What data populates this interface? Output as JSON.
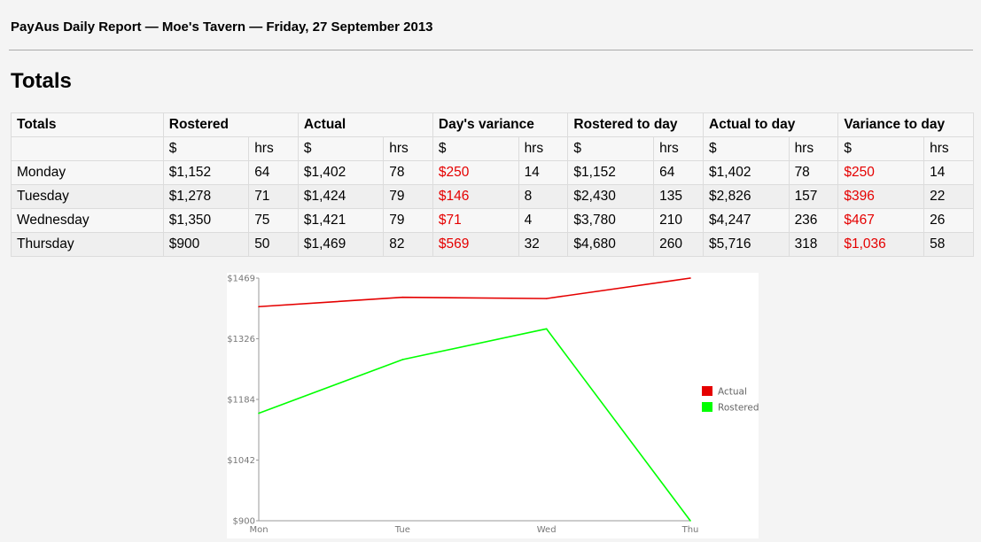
{
  "header": {
    "title": "PayAus Daily Report — Moe's Tavern — Friday, 27 September 2013"
  },
  "section": {
    "heading": "Totals"
  },
  "table": {
    "corner_label": "Totals",
    "groups": [
      "Rostered",
      "Actual",
      "Day's variance",
      "Rostered to day",
      "Actual to day",
      "Variance to day"
    ],
    "units": [
      "$",
      "hrs",
      "$",
      "hrs",
      "$",
      "hrs",
      "$",
      "hrs",
      "$",
      "hrs",
      "$",
      "hrs"
    ],
    "rows": [
      {
        "day": "Monday",
        "cells": [
          "$1,152",
          "64",
          "$1,402",
          "78",
          "$250",
          "14",
          "$1,152",
          "64",
          "$1,402",
          "78",
          "$250",
          "14"
        ]
      },
      {
        "day": "Tuesday",
        "cells": [
          "$1,278",
          "71",
          "$1,424",
          "79",
          "$146",
          "8",
          "$2,430",
          "135",
          "$2,826",
          "157",
          "$396",
          "22"
        ]
      },
      {
        "day": "Wednesday",
        "cells": [
          "$1,350",
          "75",
          "$1,421",
          "79",
          "$71",
          "4",
          "$3,780",
          "210",
          "$4,247",
          "236",
          "$467",
          "26"
        ]
      },
      {
        "day": "Thursday",
        "cells": [
          "$900",
          "50",
          "$1,469",
          "82",
          "$569",
          "32",
          "$4,680",
          "260",
          "$5,716",
          "318",
          "$1,036",
          "58"
        ]
      }
    ],
    "highlight_color": "#e50000",
    "highlight_columns": [
      4,
      10
    ]
  },
  "chart_data": {
    "type": "line",
    "categories": [
      "Mon",
      "Tue",
      "Wed",
      "Thu"
    ],
    "series": [
      {
        "name": "Actual",
        "color": "#e50000",
        "values": [
          1402,
          1424,
          1421,
          1469
        ]
      },
      {
        "name": "Rostered",
        "color": "#00ff00",
        "values": [
          1152,
          1278,
          1350,
          900
        ]
      }
    ],
    "y_ticks": [
      "$900",
      "$1042",
      "$1184",
      "$1326",
      "$1469"
    ],
    "ylim": [
      900,
      1469
    ],
    "legend_position": "right",
    "grid": false
  }
}
